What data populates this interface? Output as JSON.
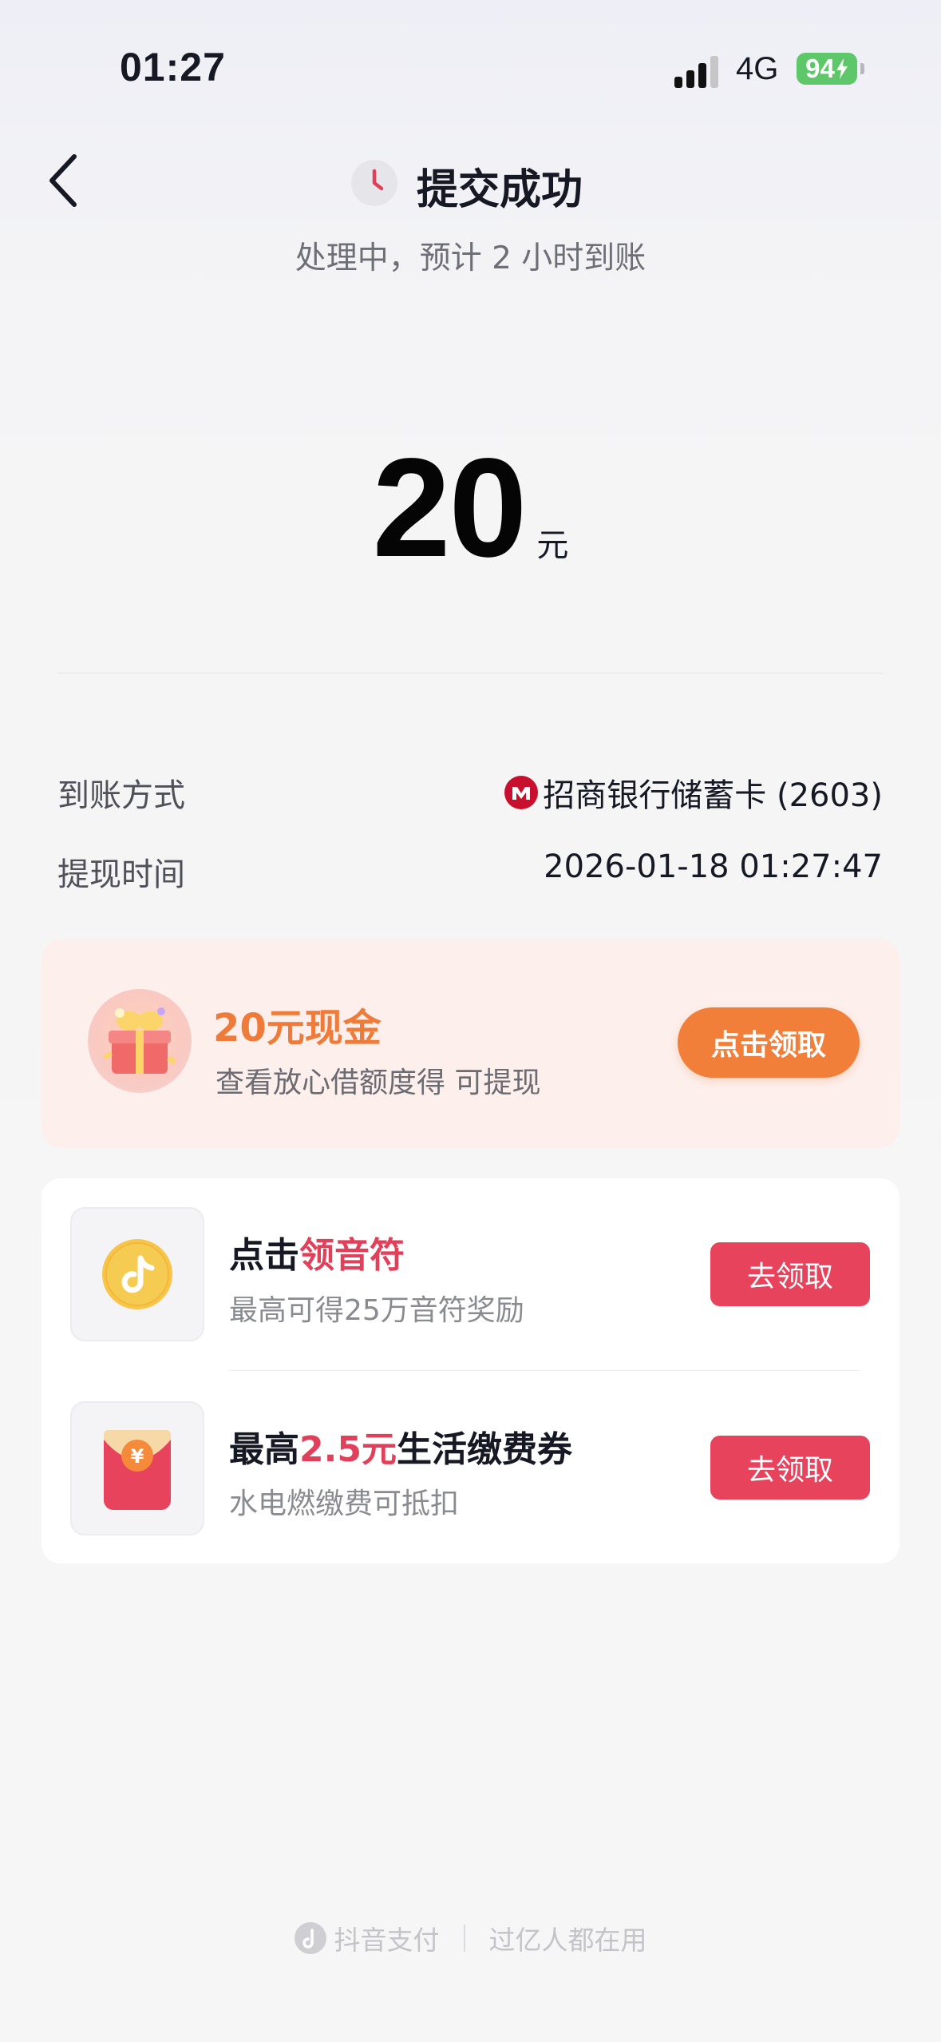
{
  "status_bar": {
    "time": "01:27",
    "network": "4G",
    "battery": "94"
  },
  "header": {
    "title": "提交成功",
    "subtitle": "处理中，预计 2 小时到账"
  },
  "amount": {
    "value": "20",
    "unit": "元"
  },
  "details": [
    {
      "label": "到账方式",
      "value": "招商银行储蓄卡 (2603)"
    },
    {
      "label": "提现时间",
      "value": "2026-01-18 01:27:47"
    }
  ],
  "cash_promo": {
    "title": "20元现金",
    "description": "查看放心借额度得 可提现",
    "button": "点击领取"
  },
  "offers": [
    {
      "title_prefix": "点击",
      "title_highlight": "领音符",
      "title_suffix": "",
      "description": "最高可得25万音符奖励",
      "button": "去领取"
    },
    {
      "title_prefix": "最高",
      "title_highlight": "2.5元",
      "title_suffix": "生活缴费券",
      "description": "水电燃缴费可抵扣",
      "button": "去领取"
    }
  ],
  "footer": {
    "brand": "抖音支付",
    "slogan": "过亿人都在用"
  },
  "colors": {
    "accent_red": "#e8435d",
    "accent_orange": "#f17f3a",
    "promo_bg": "#fdefec",
    "battery_green": "#5dc769"
  }
}
